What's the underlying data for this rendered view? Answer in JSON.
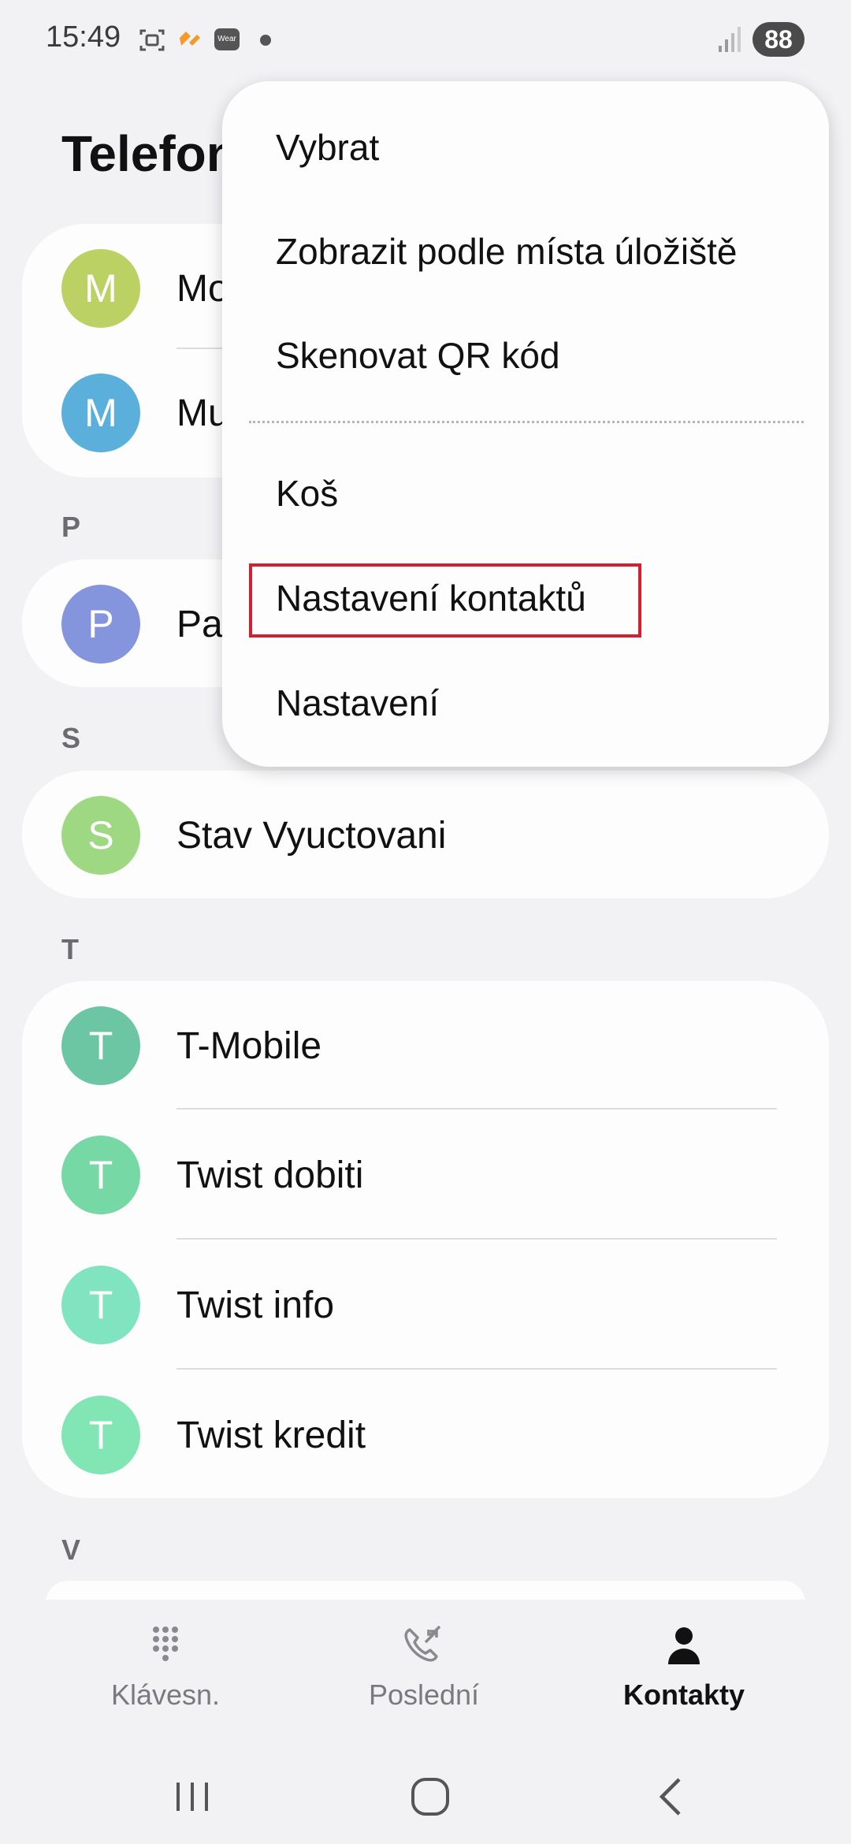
{
  "status_bar": {
    "time": "15:49",
    "wear_label": "Wear",
    "battery": "88",
    "icons": [
      "screenshot-icon",
      "hearts-icon",
      "wear-icon",
      "notification-dot-icon",
      "signal-icon",
      "battery-icon"
    ]
  },
  "header": {
    "title": "Telefon"
  },
  "contacts": {
    "groups": [
      {
        "letter": "",
        "items": [
          {
            "initial": "M",
            "name": "Mo",
            "color": "#bcd163"
          },
          {
            "initial": "M",
            "name": "Mu",
            "color": "#5bb0db"
          }
        ]
      },
      {
        "letter": "P",
        "items": [
          {
            "initial": "P",
            "name": "Pa",
            "color": "#8494dd"
          }
        ]
      },
      {
        "letter": "S",
        "items": [
          {
            "initial": "S",
            "name": "Stav Vyuctovani",
            "color": "#9ed883"
          }
        ]
      },
      {
        "letter": "T",
        "items": [
          {
            "initial": "T",
            "name": "T-Mobile",
            "color": "#6cc6a3"
          },
          {
            "initial": "T",
            "name": "Twist dobiti",
            "color": "#76d8a4"
          },
          {
            "initial": "T",
            "name": "Twist info",
            "color": "#80e4c0"
          },
          {
            "initial": "T",
            "name": "Twist kredit",
            "color": "#82e6b4"
          }
        ]
      },
      {
        "letter": "V",
        "items": []
      }
    ]
  },
  "menu": {
    "items": [
      "Vybrat",
      "Zobrazit podle místa úložiště",
      "Skenovat QR kód",
      "Koš",
      "Nastavení kontaktů",
      "Nastavení"
    ],
    "highlighted": "Nastavení kontaktů"
  },
  "bottom_nav": {
    "items": [
      {
        "label": "Klávesn.",
        "icon": "dialpad-icon",
        "active": false
      },
      {
        "label": "Poslední",
        "icon": "recent-calls-icon",
        "active": false
      },
      {
        "label": "Kontakty",
        "icon": "contacts-icon",
        "active": true
      }
    ]
  },
  "system_nav": {
    "icons": [
      "recents-icon",
      "home-icon",
      "back-icon"
    ]
  },
  "colors": {
    "background": "#f2f2f4",
    "card": "#fdfdfe",
    "highlight": "#d32030"
  }
}
